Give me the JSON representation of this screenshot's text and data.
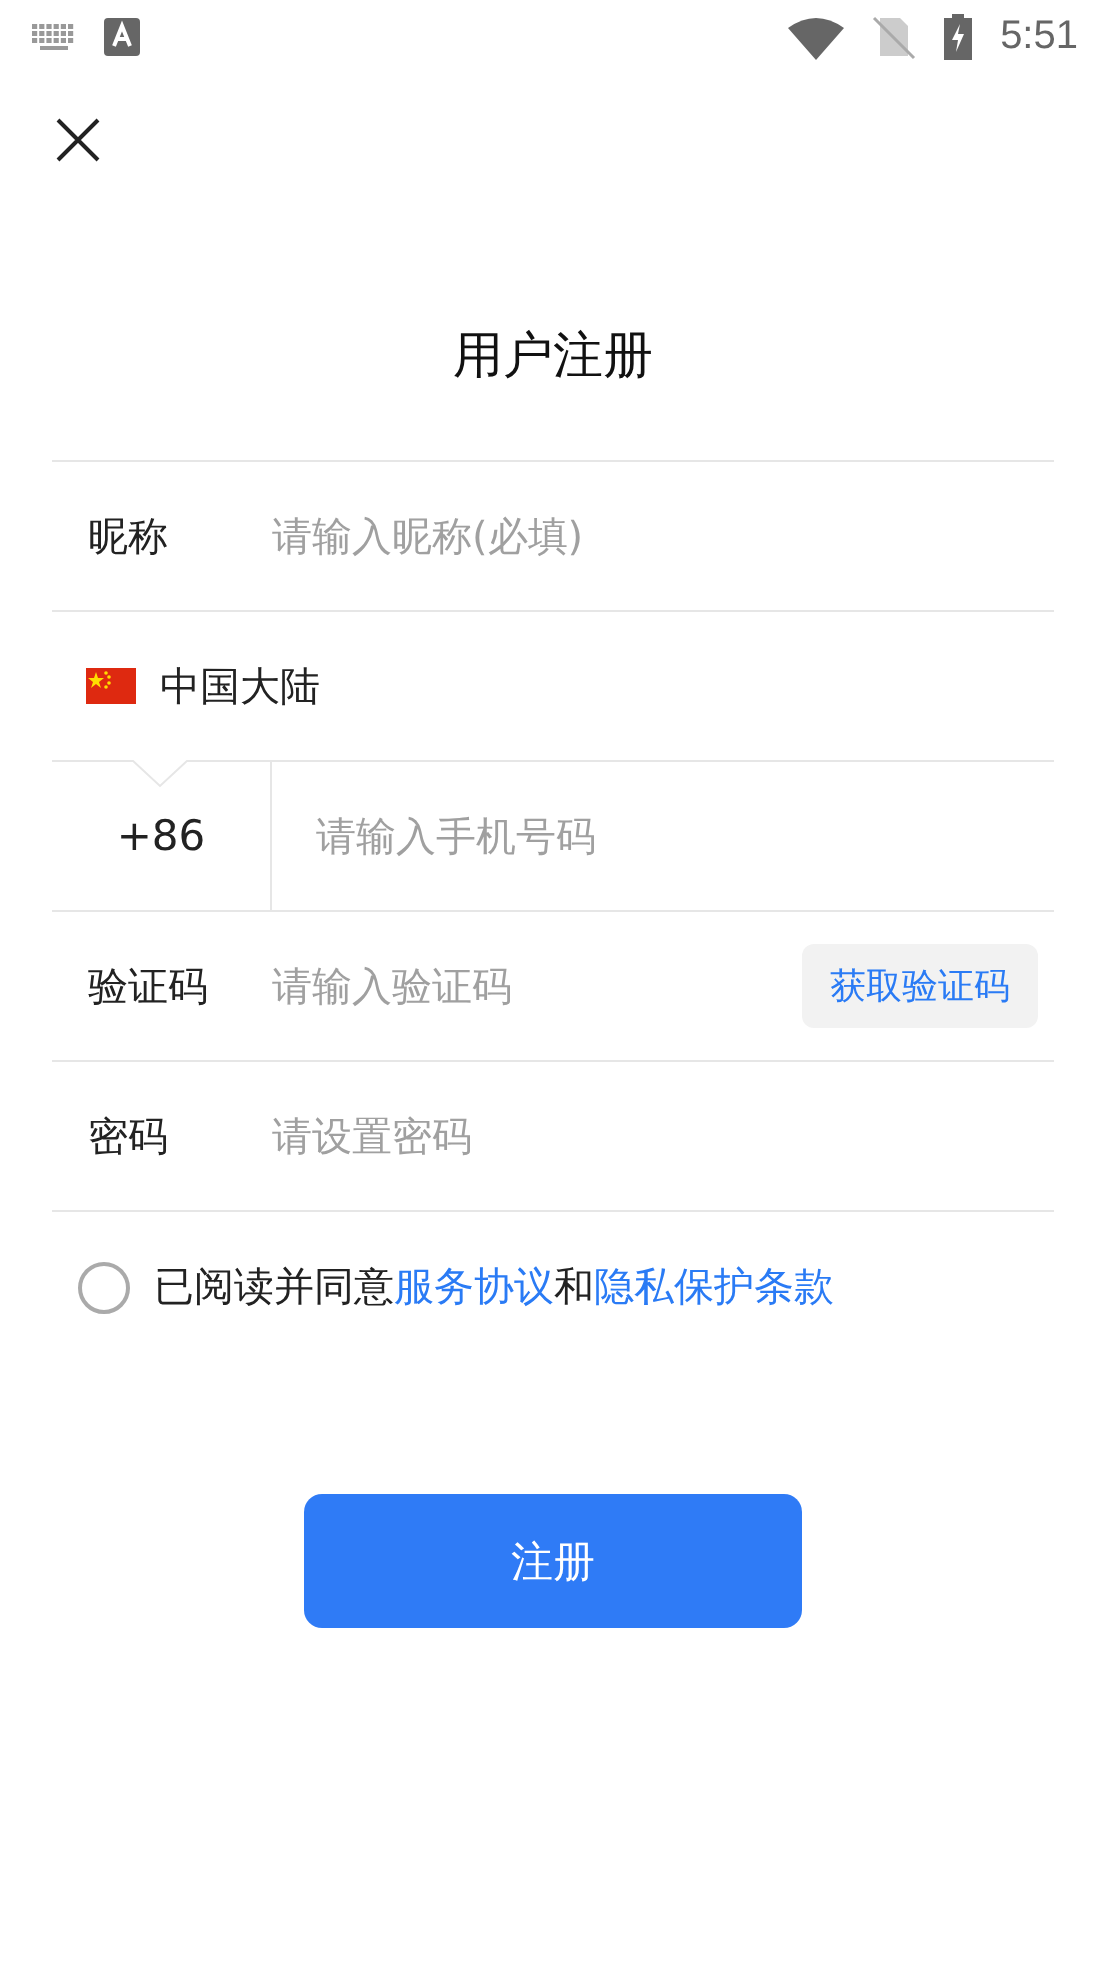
{
  "status_bar": {
    "time": "5:51"
  },
  "title": "用户注册",
  "rows": [
    {
      "kind": "text",
      "label": "昵称",
      "placeholder": "请输入昵称(必填)"
    },
    {
      "kind": "region",
      "label": "中国大陆"
    },
    {
      "kind": "phone",
      "label": "+86",
      "placeholder": "请输入手机号码"
    },
    {
      "kind": "code",
      "label": "验证码",
      "placeholder": "请输入验证码",
      "button": "获取验证码"
    },
    {
      "kind": "text",
      "label": "密码",
      "placeholder": "请设置密码"
    }
  ],
  "agreement": {
    "checked": false,
    "parts": [
      {
        "kind": "text",
        "text": "已阅读并同意"
      },
      {
        "kind": "link",
        "text": "服务协议"
      },
      {
        "kind": "text",
        "text": "和"
      },
      {
        "kind": "link",
        "text": "隐私保护条款"
      }
    ]
  },
  "submit": "注册"
}
